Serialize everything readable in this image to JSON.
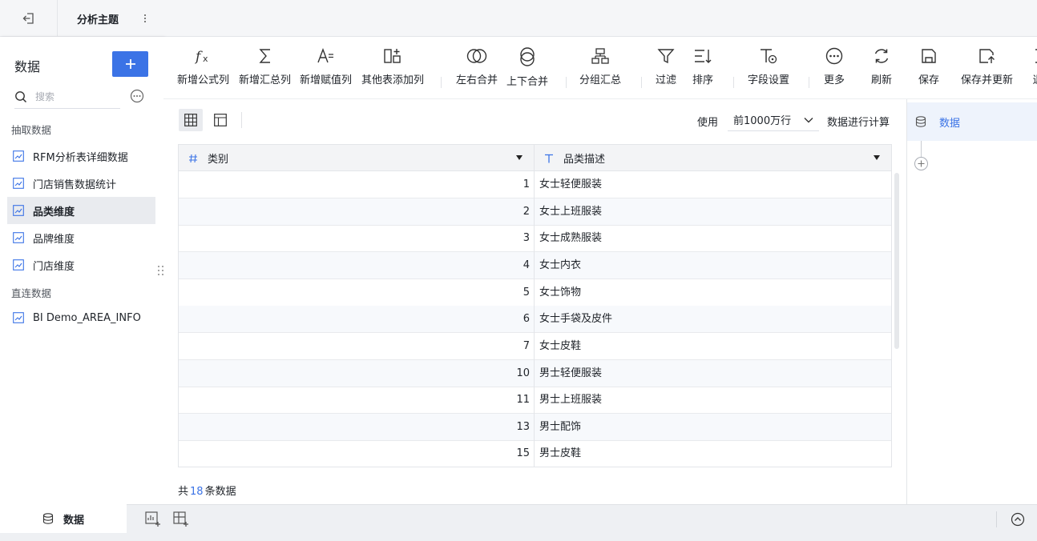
{
  "topbar": {
    "back_icon": "exit-icon",
    "title": "分析主题",
    "more_icon": "vertical-dots-icon"
  },
  "left_panel": {
    "heading": "数据",
    "add_icon": "plus-icon",
    "search_placeholder": "搜索",
    "more_icon": "ellipsis-circle-icon",
    "sections": [
      {
        "title": "抽取数据",
        "items": [
          {
            "label": "RFM分析表详细数据",
            "active": false
          },
          {
            "label": "门店销售数据统计",
            "active": false
          },
          {
            "label": "品类维度",
            "active": true
          },
          {
            "label": "品牌维度",
            "active": false
          },
          {
            "label": "门店维度",
            "active": false
          }
        ]
      },
      {
        "title": "直连数据",
        "items": [
          {
            "label": "BI Demo_AREA_INFO",
            "active": false
          }
        ]
      }
    ]
  },
  "toolbar": {
    "items": [
      {
        "label": "新增公式列",
        "icon": "fx-icon"
      },
      {
        "label": "新增汇总列",
        "icon": "sigma-icon"
      },
      {
        "label": "新增赋值列",
        "icon": "assign-value-icon"
      },
      {
        "label": "其他表添加列",
        "icon": "add-column-icon"
      },
      {
        "label": "左右合并",
        "icon": "horizontal-merge-icon"
      },
      {
        "label": "上下合并",
        "icon": "vertical-merge-icon"
      },
      {
        "label": "分组汇总",
        "icon": "group-summary-icon"
      },
      {
        "label": "过滤",
        "icon": "filter-icon"
      },
      {
        "label": "排序",
        "icon": "sort-icon"
      },
      {
        "label": "字段设置",
        "icon": "field-settings-icon"
      },
      {
        "label": "更多",
        "icon": "more-circle-icon"
      },
      {
        "label": "刷新",
        "icon": "refresh-icon"
      },
      {
        "label": "保存",
        "icon": "save-icon"
      },
      {
        "label": "保存并更新",
        "icon": "save-update-icon"
      },
      {
        "label": "退",
        "icon": "exit-icon"
      }
    ]
  },
  "main": {
    "view_buttons": [
      {
        "icon": "table-view-icon",
        "active": true
      },
      {
        "icon": "layout-view-icon",
        "active": false
      }
    ],
    "use_label": "使用",
    "row_limit": "前1000万行",
    "calc_label": "数据进行计算",
    "columns": [
      {
        "type_icon": "number-type-icon",
        "name": "类别"
      },
      {
        "type_icon": "text-type-icon",
        "name": "品类描述"
      }
    ],
    "rows": [
      {
        "category": "1",
        "desc": "女士轻便服装"
      },
      {
        "category": "2",
        "desc": "女士上班服装"
      },
      {
        "category": "3",
        "desc": "女士成熟服装"
      },
      {
        "category": "4",
        "desc": "女士内衣"
      },
      {
        "category": "5",
        "desc": "女士饰物"
      },
      {
        "category": "6",
        "desc": "女士手袋及皮件"
      },
      {
        "category": "7",
        "desc": "女士皮鞋"
      },
      {
        "category": "10",
        "desc": "男士轻便服装"
      },
      {
        "category": "11",
        "desc": "男士上班服装"
      },
      {
        "category": "13",
        "desc": "男士配饰"
      },
      {
        "category": "15",
        "desc": "男士皮鞋"
      }
    ],
    "footer": {
      "prefix": "共",
      "count": "18",
      "suffix": "条数据"
    }
  },
  "right_panel": {
    "node_label": "数据",
    "node_icon": "database-icon",
    "add_icon": "plus-circle-icon"
  },
  "bottombar": {
    "tab_label": "数据",
    "tab_icon": "database-icon",
    "icons": [
      "add-component-icon",
      "add-dashboard-icon"
    ],
    "collapse_icon": "chevron-up-circle-icon"
  },
  "colors": {
    "accent": "#3b73e6",
    "header_bg": "#f3f4f6",
    "alt_row": "#f7f9fc",
    "active_item": "#e9ebef"
  }
}
